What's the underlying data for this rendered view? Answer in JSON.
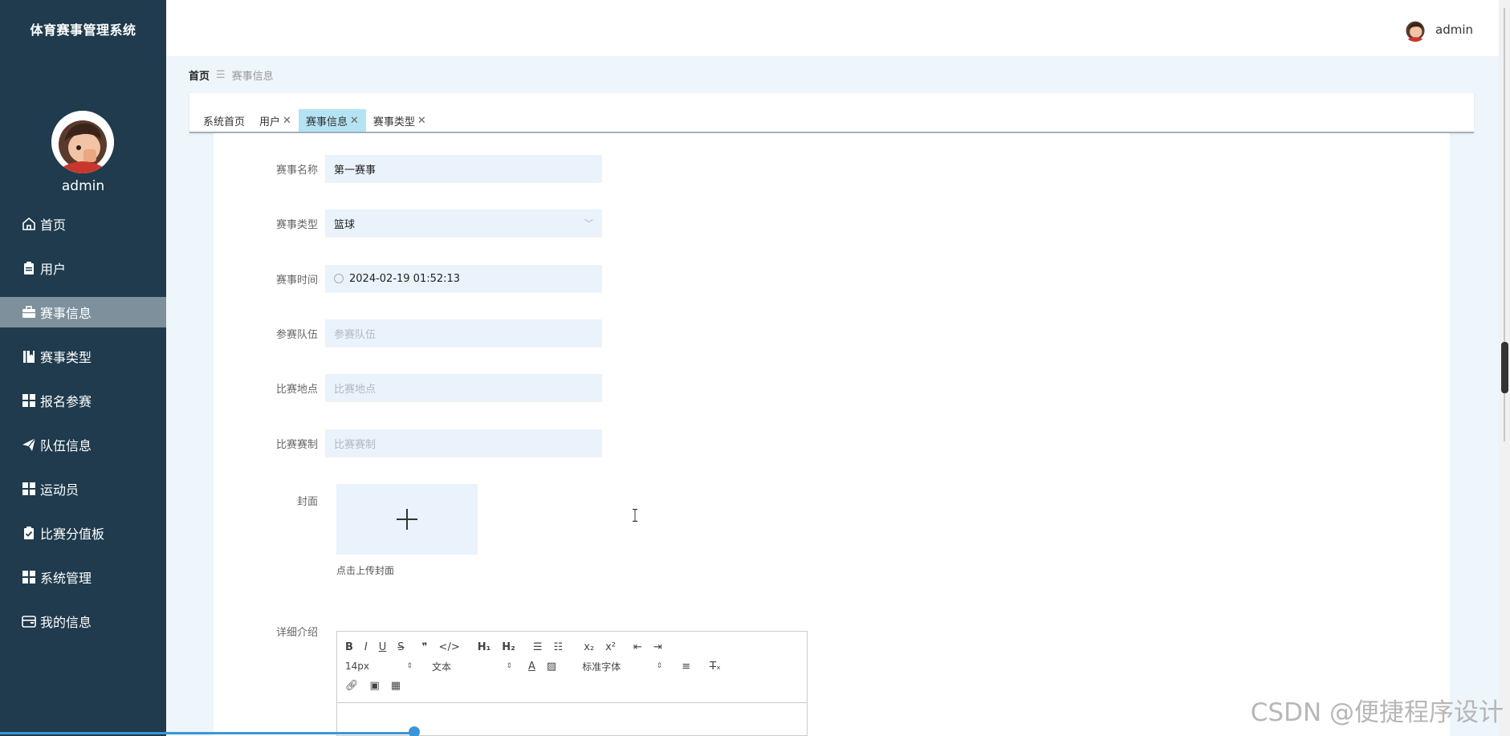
{
  "app": {
    "title": "体育赛事管理系统"
  },
  "user": {
    "name": "admin"
  },
  "sidebar": {
    "items": [
      {
        "label": "首页",
        "icon": "home-icon",
        "active": false
      },
      {
        "label": "用户",
        "icon": "clipboard-icon",
        "active": false
      },
      {
        "label": "赛事信息",
        "icon": "briefcase-icon",
        "active": true
      },
      {
        "label": "赛事类型",
        "icon": "book-icon",
        "active": false
      },
      {
        "label": "报名参赛",
        "icon": "grid-icon",
        "active": false
      },
      {
        "label": "队伍信息",
        "icon": "send-icon",
        "active": false
      },
      {
        "label": "运动员",
        "icon": "grid-icon",
        "active": false
      },
      {
        "label": "比赛分值板",
        "icon": "clipboard-check-icon",
        "active": false
      },
      {
        "label": "系统管理",
        "icon": "grid-icon",
        "active": false
      },
      {
        "label": "我的信息",
        "icon": "wallet-icon",
        "active": false
      }
    ]
  },
  "breadcrumb": {
    "home": "首页",
    "separator": "☰",
    "current": "赛事信息"
  },
  "tabs": [
    {
      "label": "系统首页",
      "closable": false,
      "active": false
    },
    {
      "label": "用户",
      "closable": true,
      "active": false
    },
    {
      "label": "赛事信息",
      "closable": true,
      "active": true
    },
    {
      "label": "赛事类型",
      "closable": true,
      "active": false
    }
  ],
  "form": {
    "name": {
      "label": "赛事名称",
      "value": "第一赛事"
    },
    "type": {
      "label": "赛事类型",
      "value": "篮球"
    },
    "time": {
      "label": "赛事时间",
      "value": "2024-02-19 01:52:13"
    },
    "teams": {
      "label": "参赛队伍",
      "placeholder": "参赛队伍"
    },
    "venue": {
      "label": "比赛地点",
      "placeholder": "比赛地点"
    },
    "format": {
      "label": "比赛赛制",
      "placeholder": "比赛赛制"
    },
    "cover": {
      "label": "封面",
      "hint": "点击上传封面"
    },
    "detail": {
      "label": "详细介绍"
    }
  },
  "editor": {
    "font_size": "14px",
    "header_select": "文本",
    "font_family": "标准字体"
  },
  "watermark": "CSDN @便捷程序设计",
  "colors": {
    "sidebar_bg": "#1f3b4d",
    "sidebar_active": "#7d909c",
    "tab_active": "#b4e3f3",
    "field_bg": "#eaf3fb"
  }
}
